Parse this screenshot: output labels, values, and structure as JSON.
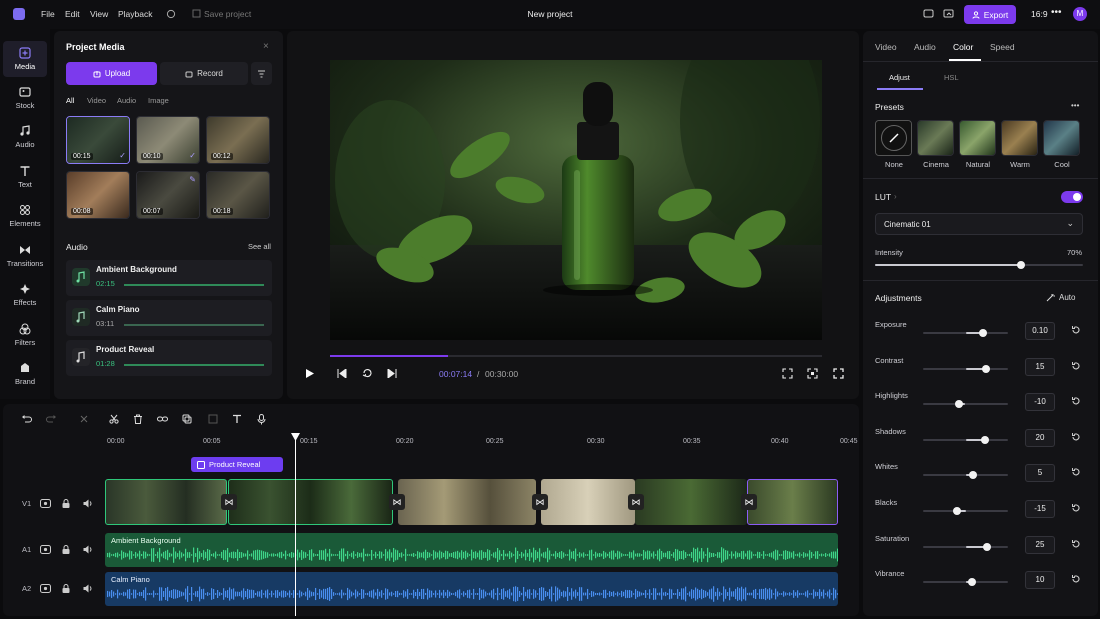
{
  "app": {
    "project_title": "New project",
    "save_label": "Save project",
    "export_label": "Export",
    "aspect": "16:9",
    "avatar": "M"
  },
  "menu": [
    "File",
    "Edit",
    "View",
    "Playback"
  ],
  "rail": [
    {
      "label": "Media",
      "icon": "media-icon",
      "active": true
    },
    {
      "label": "Stock",
      "icon": "stock-icon"
    },
    {
      "label": "Audio",
      "icon": "audio-icon"
    },
    {
      "label": "Text",
      "icon": "text-icon"
    },
    {
      "label": "Elements",
      "icon": "elements-icon"
    },
    {
      "label": "Transitions",
      "icon": "transitions-icon"
    },
    {
      "label": "Effects",
      "icon": "effects-icon"
    },
    {
      "label": "Filters",
      "icon": "filters-icon"
    },
    {
      "label": "Brand",
      "icon": "brand-icon"
    }
  ],
  "media": {
    "title": "Project Media",
    "upload_label": "Upload",
    "record_label": "Record",
    "filters": [
      "All",
      "Video",
      "Audio",
      "Image"
    ],
    "thumbs": [
      "00:15",
      "00:10",
      "00:12",
      "00:08",
      "00:07",
      "00:18"
    ],
    "audio_title": "Audio",
    "see_all": "See all",
    "audio": [
      {
        "name": "Ambient Background",
        "time": "02:15"
      },
      {
        "name": "Calm Piano",
        "time": "03:11"
      },
      {
        "name": "Product Reveal",
        "time": "01:28"
      }
    ]
  },
  "player": {
    "current": "00:07:14",
    "separator": "/",
    "total": "00:30:00",
    "progress": 0.24
  },
  "right": {
    "tabs": [
      "Video",
      "Audio",
      "Color",
      "Speed"
    ],
    "active_tab": "Color",
    "subtabs": [
      "Adjust",
      "HSL"
    ],
    "presets_title": "Presets",
    "presets": [
      "None",
      "Cinema",
      "Natural",
      "Warm",
      "Cool"
    ],
    "lut_title": "LUT",
    "lut_enabled": true,
    "lut_value": "Cinematic 01",
    "intensity_label": "Intensity",
    "intensity_value": "70%",
    "intensity": 0.7,
    "adjustments_title": "Adjustments",
    "auto_label": "Auto",
    "adjustments": [
      {
        "label": "Exposure",
        "value": "0.10",
        "pos": 0.7
      },
      {
        "label": "Contrast",
        "value": "15",
        "pos": 0.74
      },
      {
        "label": "Highlights",
        "value": "-10",
        "pos": 0.42
      },
      {
        "label": "Shadows",
        "value": "20",
        "pos": 0.73
      },
      {
        "label": "Whites",
        "value": "5",
        "pos": 0.59
      },
      {
        "label": "Blacks",
        "value": "-15",
        "pos": 0.4
      },
      {
        "label": "Saturation",
        "value": "25",
        "pos": 0.75
      },
      {
        "label": "Vibrance",
        "value": "10",
        "pos": 0.58
      }
    ]
  },
  "timeline": {
    "ticks": [
      "00:00",
      "00:05",
      "00:15",
      "00:20",
      "00:25",
      "00:30",
      "00:35",
      "00:40",
      "00:45"
    ],
    "text_clip": "Product Reveal",
    "tracks": [
      "V1",
      "A1",
      "A2"
    ],
    "audio1": "Ambient Background",
    "audio2": "Calm Piano"
  },
  "colors": {
    "accent": "#6d28d9",
    "accent_bright": "#7c3aed",
    "audio_green": "#2fa866",
    "audio_blue": "#2f6fd0"
  }
}
